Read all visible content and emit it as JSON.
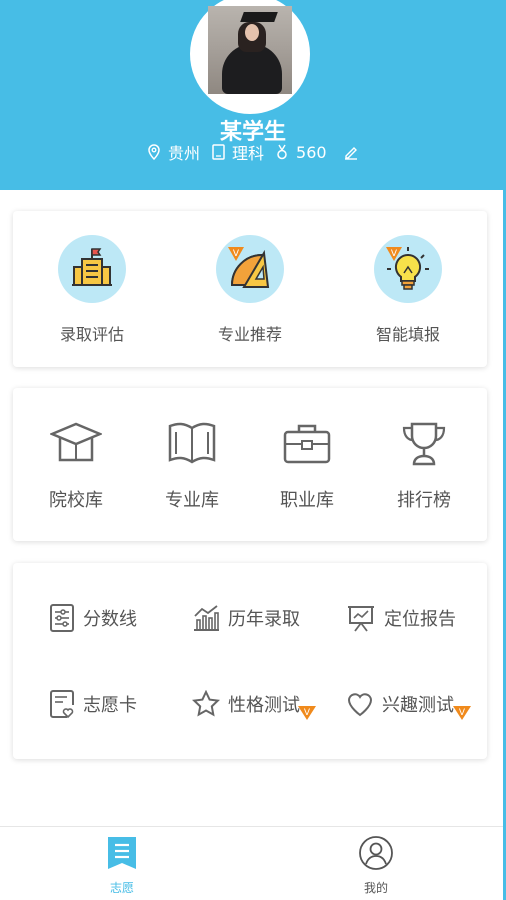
{
  "header": {
    "student_name": "某学生",
    "province": "贵州",
    "subject": "理科",
    "score": "560"
  },
  "features": [
    {
      "label": "录取评估",
      "icon": "school-building-icon",
      "vip": false
    },
    {
      "label": "专业推荐",
      "icon": "ruler-triangle-icon",
      "vip": true
    },
    {
      "label": "智能填报",
      "icon": "lightbulb-icon",
      "vip": true
    }
  ],
  "libraries": [
    {
      "label": "院校库",
      "icon": "graduation-cap-icon"
    },
    {
      "label": "专业库",
      "icon": "open-book-icon"
    },
    {
      "label": "职业库",
      "icon": "briefcase-icon"
    },
    {
      "label": "排行榜",
      "icon": "trophy-icon"
    }
  ],
  "tools": [
    {
      "label": "分数线",
      "icon": "score-line-icon",
      "vip": false
    },
    {
      "label": "历年录取",
      "icon": "bar-chart-icon",
      "vip": false
    },
    {
      "label": "定位报告",
      "icon": "presentation-board-icon",
      "vip": false
    },
    {
      "label": "志愿卡",
      "icon": "heart-document-icon",
      "vip": false
    },
    {
      "label": "性格测试",
      "icon": "star-icon",
      "vip": true
    },
    {
      "label": "兴趣测试",
      "icon": "heart-icon",
      "vip": true
    }
  ],
  "vip_badge": "V",
  "tabbar": {
    "tabs": [
      {
        "label": "志愿",
        "active": true
      },
      {
        "label": "我的",
        "active": false
      }
    ]
  },
  "colors": {
    "header": "#47bde6",
    "icon_circle": "#bde8f6",
    "vip_badge": "#f08a1c",
    "active_tab": "#47bde6"
  }
}
